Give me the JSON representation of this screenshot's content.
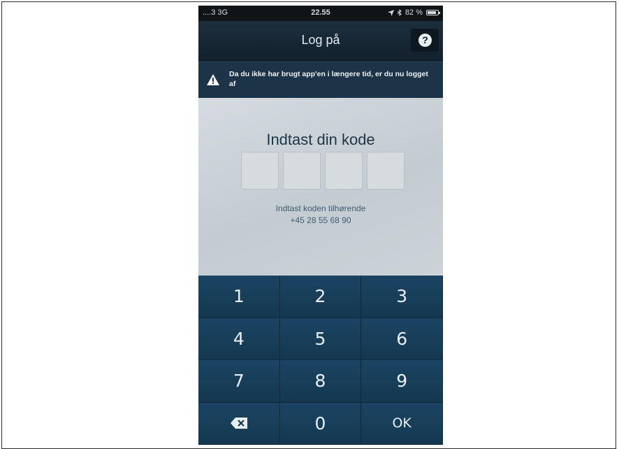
{
  "status_bar": {
    "carrier": "....3  3G",
    "time": "22.55",
    "battery": "82 %"
  },
  "header": {
    "title": "Log på",
    "help_icon": "question-icon"
  },
  "alert": {
    "icon": "warning-icon",
    "message": "Da du ikke har brugt app'en i længere tid, er du nu logget af"
  },
  "main": {
    "prompt": "Indtast din kode",
    "code_length": 4,
    "hint_line1": "Indtast koden tilhørende",
    "phone_number": "+45 28 55 68 90"
  },
  "keypad": {
    "keys": [
      "1",
      "2",
      "3",
      "4",
      "5",
      "6",
      "7",
      "8",
      "9",
      "",
      "0",
      "OK"
    ],
    "delete_icon": "backspace-icon"
  },
  "colors": {
    "navbar": "#12202c",
    "alert": "#1d3347",
    "keypad": "#153852",
    "text_dark": "#1c3548"
  }
}
